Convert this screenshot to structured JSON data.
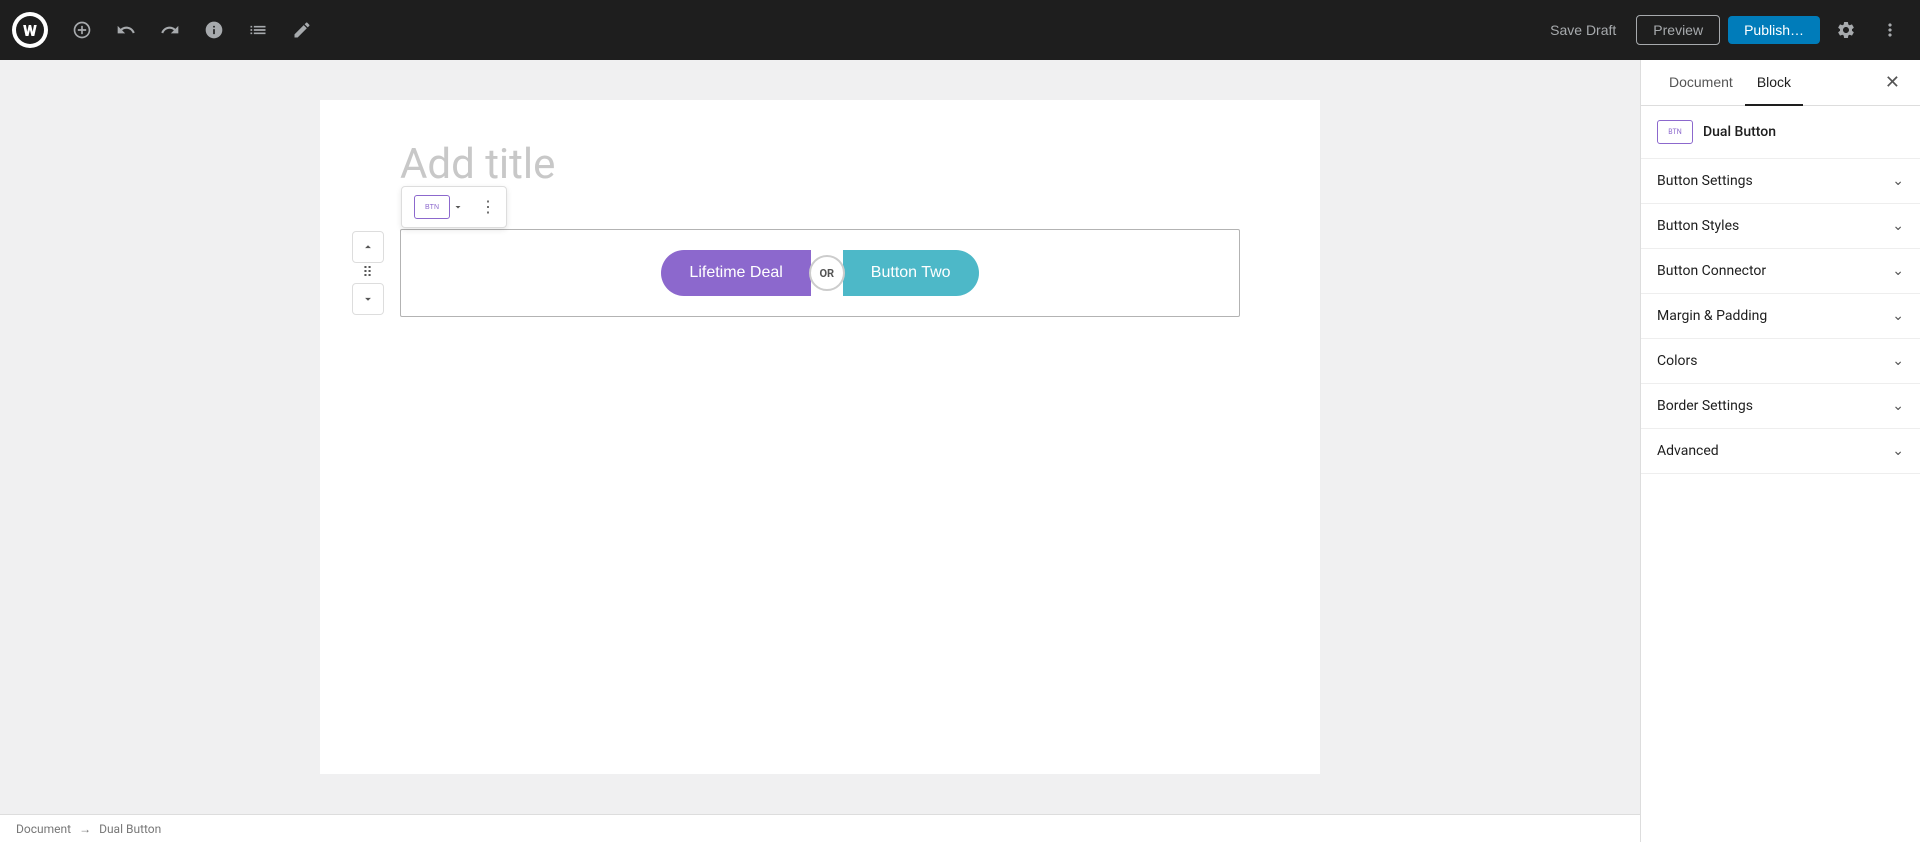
{
  "toolbar": {
    "save_draft_label": "Save Draft",
    "preview_label": "Preview",
    "publish_label": "Publish…"
  },
  "editor": {
    "title_placeholder": "Add title"
  },
  "block": {
    "btn_left_text": "Lifetime Deal",
    "connector_text": "OR",
    "btn_right_text": "Button Two"
  },
  "sidebar": {
    "tab_document": "Document",
    "tab_block": "Block",
    "block_name": "Dual Button",
    "sections": [
      {
        "id": "button-settings",
        "label": "Button Settings"
      },
      {
        "id": "button-styles",
        "label": "Button Styles"
      },
      {
        "id": "button-connector",
        "label": "Button Connector"
      },
      {
        "id": "margin-padding",
        "label": "Margin & Padding"
      },
      {
        "id": "colors",
        "label": "Colors"
      },
      {
        "id": "border-settings",
        "label": "Border Settings"
      },
      {
        "id": "advanced",
        "label": "Advanced"
      }
    ]
  },
  "status_bar": {
    "breadcrumb_root": "Document",
    "breadcrumb_separator": "→",
    "breadcrumb_current": "Dual Button"
  }
}
